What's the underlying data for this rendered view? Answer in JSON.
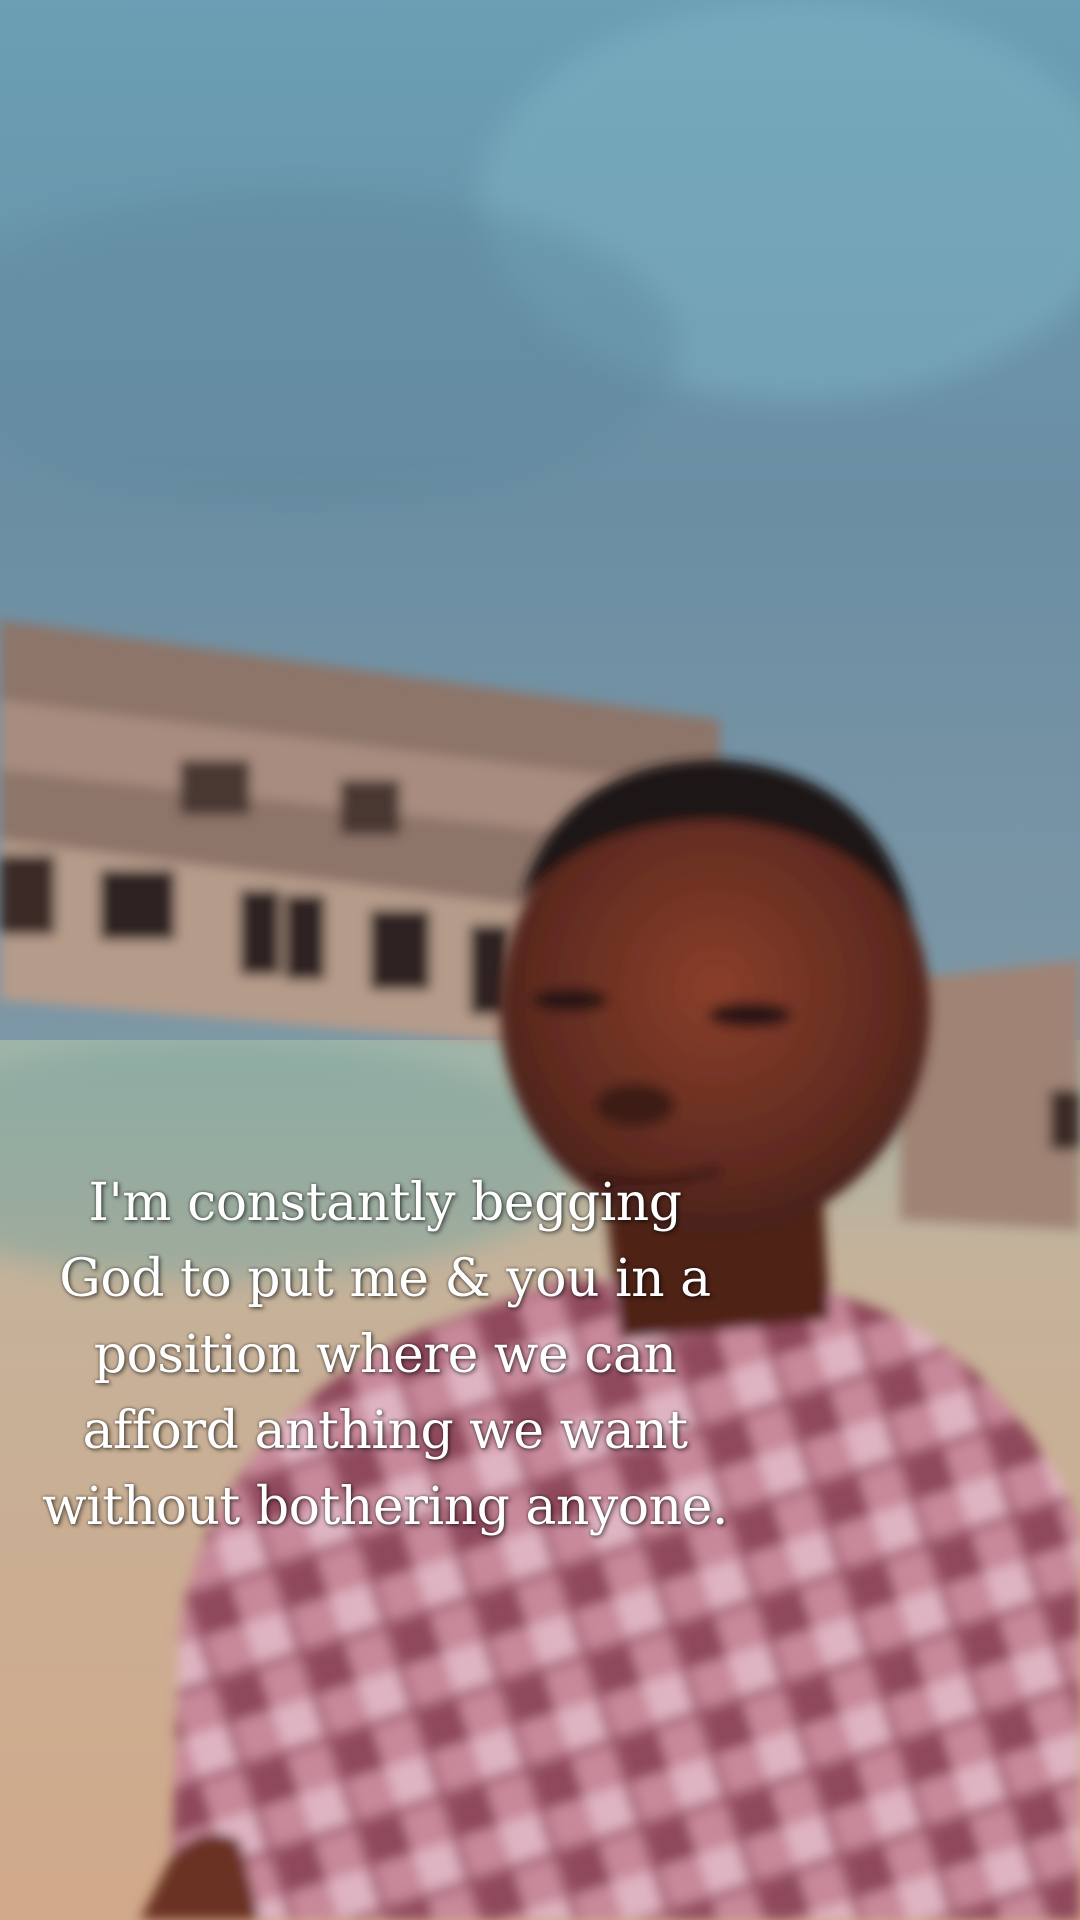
{
  "caption": {
    "lines": [
      "I'm constantly begging",
      "God to put me & you in a",
      "position where we can",
      "afford anthing we want",
      "without bothering anyone."
    ]
  },
  "colors": {
    "sky": "#6e93a6",
    "ground": "#c9a98a",
    "building": "#8a6f63",
    "skin": "#6b2f22",
    "shirt": "#c9889a",
    "caption_text": "#ffffff"
  }
}
